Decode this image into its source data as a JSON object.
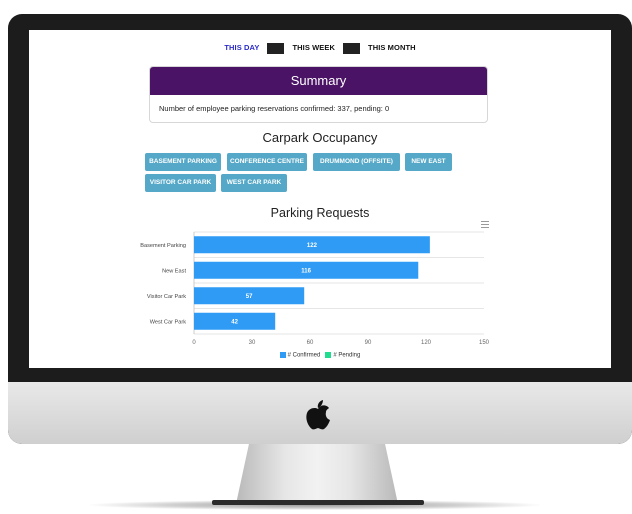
{
  "tabs": [
    {
      "label": "THIS DAY",
      "active": true
    },
    {
      "label": "THIS WEEK",
      "active": false
    },
    {
      "label": "THIS MONTH",
      "active": false
    }
  ],
  "summary": {
    "title": "Summary",
    "text": "Number of employee parking reservations confirmed: 337, pending: 0"
  },
  "occupancy": {
    "title": "Carpark Occupancy",
    "chips": [
      "BASEMENT PARKING",
      "CONFERENCE CENTRE",
      "DRUMMOND (OFFSITE)",
      "NEW EAST",
      "VISITOR CAR PARK",
      "WEST CAR PARK"
    ]
  },
  "chart_data": {
    "type": "bar",
    "orientation": "horizontal",
    "title": "Parking Requests",
    "categories": [
      "Basement Parking",
      "New East",
      "Visitor Car Park",
      "West Car Park"
    ],
    "series": [
      {
        "name": "# Confirmed",
        "color": "#2f9bf5",
        "values": [
          122,
          116,
          57,
          42
        ]
      },
      {
        "name": "# Pending",
        "color": "#1fdc8f",
        "values": [
          0,
          0,
          0,
          0
        ]
      }
    ],
    "xlim": [
      0,
      150
    ],
    "xticks": [
      0,
      30,
      60,
      90,
      120,
      150
    ],
    "grid": true,
    "legend": "bottom"
  },
  "colors": {
    "accent": "#4a1366",
    "chip": "#55a8c7",
    "active_tab": "#2a2ac9"
  }
}
